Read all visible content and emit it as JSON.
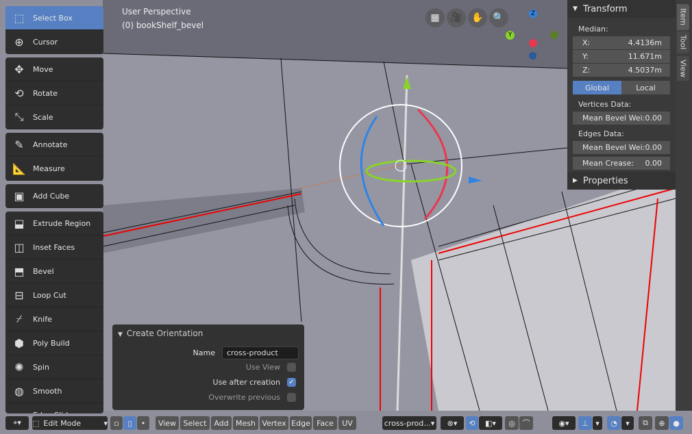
{
  "viewport": {
    "title": "User Perspective",
    "object": "(0) bookShelf_bevel"
  },
  "toolbar": [
    {
      "label": "Select Box",
      "icon": "select-box-icon",
      "glyph": "⬚",
      "active": true,
      "group": 0
    },
    {
      "label": "Cursor",
      "icon": "cursor-icon",
      "glyph": "⊕",
      "group": 0
    },
    {
      "label": "Move",
      "icon": "move-icon",
      "glyph": "✥",
      "group": 1
    },
    {
      "label": "Rotate",
      "icon": "rotate-icon",
      "glyph": "⟲",
      "group": 1
    },
    {
      "label": "Scale",
      "icon": "scale-icon",
      "glyph": "⤡",
      "group": 1
    },
    {
      "label": "Annotate",
      "icon": "annotate-icon",
      "glyph": "✎",
      "group": 2
    },
    {
      "label": "Measure",
      "icon": "measure-icon",
      "glyph": "📐",
      "group": 2
    },
    {
      "label": "Add Cube",
      "icon": "add-cube-icon",
      "glyph": "▣",
      "group": 3
    },
    {
      "label": "Extrude Region",
      "icon": "extrude-icon",
      "glyph": "⬓",
      "group": 4
    },
    {
      "label": "Inset Faces",
      "icon": "inset-icon",
      "glyph": "◫",
      "group": 4
    },
    {
      "label": "Bevel",
      "icon": "bevel-icon",
      "glyph": "⬒",
      "group": 4
    },
    {
      "label": "Loop Cut",
      "icon": "loop-cut-icon",
      "glyph": "⊟",
      "group": 4
    },
    {
      "label": "Knife",
      "icon": "knife-icon",
      "glyph": "⌿",
      "group": 4
    },
    {
      "label": "Poly Build",
      "icon": "poly-build-icon",
      "glyph": "⬢",
      "group": 4
    },
    {
      "label": "Spin",
      "icon": "spin-icon",
      "glyph": "✺",
      "group": 4
    },
    {
      "label": "Smooth",
      "icon": "smooth-icon",
      "glyph": "◍",
      "group": 4
    },
    {
      "label": "Edge Slide",
      "icon": "edge-slide-icon",
      "glyph": "▭",
      "group": 4
    }
  ],
  "nav_buttons": [
    {
      "icon": "perspective-grid-icon",
      "glyph": "▦"
    },
    {
      "icon": "camera-icon",
      "glyph": "🎥"
    },
    {
      "icon": "hand-pan-icon",
      "glyph": "✋"
    },
    {
      "icon": "zoom-icon",
      "glyph": "🔍"
    }
  ],
  "gizmo": {
    "z": "Z",
    "y": "Y"
  },
  "transform_panel": {
    "title": "Transform",
    "median_label": "Median:",
    "fields": [
      {
        "axis": "X:",
        "value": "4.4136m"
      },
      {
        "axis": "Y:",
        "value": "11.671m"
      },
      {
        "axis": "Z:",
        "value": "4.5037m"
      }
    ],
    "space": [
      "Global",
      "Local"
    ],
    "space_selected": "Global",
    "vertices_label": "Vertices Data:",
    "vertices": [
      {
        "label": "Mean Bevel Wei:",
        "value": "0.00"
      }
    ],
    "edges_label": "Edges Data:",
    "edges": [
      {
        "label": "Mean Bevel Wei:",
        "value": "0.00"
      },
      {
        "label": "Mean Crease:",
        "value": "0.00"
      }
    ],
    "properties_label": "Properties"
  },
  "side_tabs": [
    "Item",
    "Tool",
    "View"
  ],
  "side_tab_active": "Item",
  "operator_panel": {
    "title": "Create Orientation",
    "name_label": "Name",
    "name_value": "cross-product",
    "options": [
      {
        "label": "Use View",
        "checked": false
      },
      {
        "label": "Use after creation",
        "checked": true
      },
      {
        "label": "Overwrite previous",
        "checked": false
      }
    ]
  },
  "bottom_bar": {
    "mode": "Edit Mode",
    "menus": [
      "View",
      "Select",
      "Add",
      "Mesh",
      "Vertex",
      "Edge",
      "Face",
      "UV"
    ],
    "orientation": "cross-prod..."
  },
  "colors": {
    "accent": "#5680c2",
    "x_axis": "#e8384f",
    "y_axis": "#8ad22a",
    "z_axis": "#2f84e3"
  }
}
